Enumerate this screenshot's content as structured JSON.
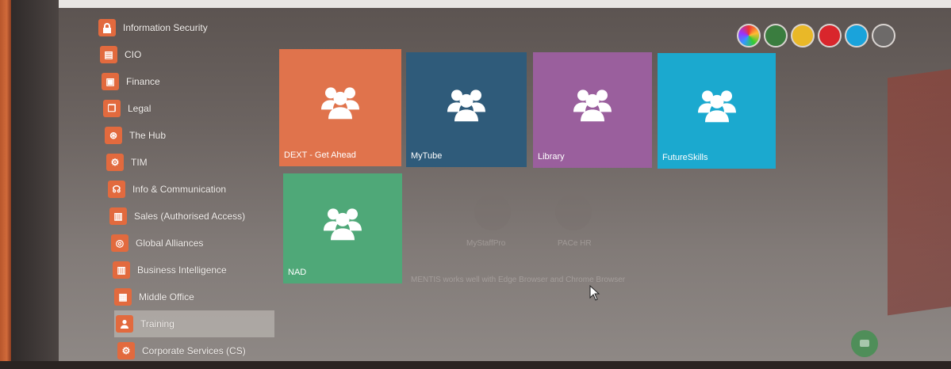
{
  "sidebar": {
    "items": [
      {
        "label": "Information Security",
        "icon": "lock-icon",
        "glyph": "🔒"
      },
      {
        "label": "CIO",
        "icon": "document-icon",
        "glyph": "▤"
      },
      {
        "label": "Finance",
        "icon": "money-icon",
        "glyph": "▣"
      },
      {
        "label": "Legal",
        "icon": "copy-icon",
        "glyph": "❐"
      },
      {
        "label": "The Hub",
        "icon": "basketball-icon",
        "glyph": "⊛"
      },
      {
        "label": "TIM",
        "icon": "cogs-icon",
        "glyph": "⚙"
      },
      {
        "label": "Info & Communication",
        "icon": "headset-icon",
        "glyph": "☊"
      },
      {
        "label": "Sales (Authorised Access)",
        "icon": "bar-chart-icon",
        "glyph": "▥"
      },
      {
        "label": "Global Alliances",
        "icon": "globe-icon",
        "glyph": "◎"
      },
      {
        "label": "Business Intelligence",
        "icon": "bar-chart-icon",
        "glyph": "▥"
      },
      {
        "label": "Middle Office",
        "icon": "building-icon",
        "glyph": "▦"
      },
      {
        "label": "Training",
        "icon": "users-icon",
        "glyph": "👥",
        "active": true
      },
      {
        "label": "Corporate Services (CS)",
        "icon": "cogs-icon",
        "glyph": "⚙"
      }
    ]
  },
  "theme_swatches": [
    "rainbow",
    "#3a7d3f",
    "#e9b828",
    "#d9262c",
    "#1aa3db",
    "#6d6a69"
  ],
  "tiles": [
    {
      "label": "DEXT - Get Ahead",
      "color": "#e0734c"
    },
    {
      "label": "MyTube",
      "color": "#2f5b7a"
    },
    {
      "label": "Library",
      "color": "#9a5f9d"
    },
    {
      "label": "FutureSkills",
      "color": "#1ba9cf"
    },
    {
      "label": "NAD",
      "color": "#4fa878"
    }
  ],
  "ghost": {
    "item_1": "MyStaffPro",
    "item_2": "PACe HR",
    "notice": "MENTIS works well with Edge Browser and Chrome Browser"
  }
}
